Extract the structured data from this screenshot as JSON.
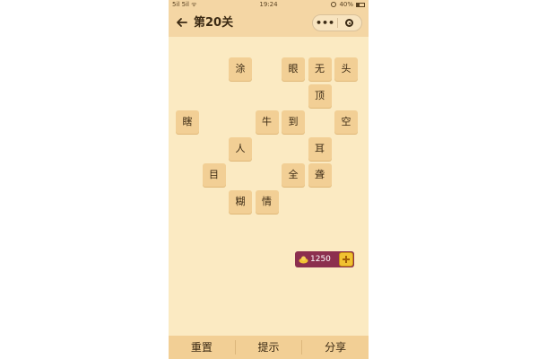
{
  "status": {
    "signal": "5il 5il ᯤ",
    "time": "19:24",
    "battery": "40%"
  },
  "nav": {
    "title": "第20关",
    "menu_glyph": "•••"
  },
  "tiles": [
    {
      "char": "涂",
      "row": 0,
      "col": 2
    },
    {
      "char": "眼",
      "row": 0,
      "col": 4
    },
    {
      "char": "无",
      "row": 0,
      "col": 5
    },
    {
      "char": "头",
      "row": 0,
      "col": 6
    },
    {
      "char": "顶",
      "row": 1,
      "col": 5
    },
    {
      "char": "瞎",
      "row": 2,
      "col": 0
    },
    {
      "char": "牛",
      "row": 2,
      "col": 3
    },
    {
      "char": "到",
      "row": 2,
      "col": 4
    },
    {
      "char": "空",
      "row": 2,
      "col": 6
    },
    {
      "char": "人",
      "row": 3,
      "col": 2
    },
    {
      "char": "耳",
      "row": 3,
      "col": 5
    },
    {
      "char": "目",
      "row": 4,
      "col": 1
    },
    {
      "char": "全",
      "row": 4,
      "col": 4
    },
    {
      "char": "聋",
      "row": 4,
      "col": 5
    },
    {
      "char": "糊",
      "row": 5,
      "col": 2
    },
    {
      "char": "情",
      "row": 5,
      "col": 3
    }
  ],
  "coins": {
    "value": "1250"
  },
  "bottom": {
    "reset": "重置",
    "hint": "提示",
    "share": "分享"
  },
  "colors": {
    "background": "#fbeac2",
    "tile": "#f2cf95",
    "navbar": "#f4d6a4",
    "coin_badge": "#8c2f4e"
  }
}
